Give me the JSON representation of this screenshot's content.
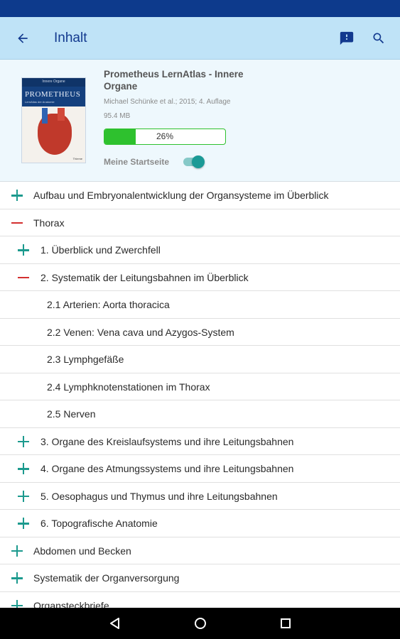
{
  "app_bar": {
    "title": "Inhalt",
    "back_icon": "arrow-back-icon",
    "actions": [
      "feedback-icon",
      "search-icon"
    ],
    "background": "#bfe3f7",
    "title_color": "#12398e"
  },
  "book": {
    "title": "Prometheus LernAtlas - Innere Organe",
    "author": "Michael Schünke et al.; 2015; 4. Auflage",
    "size": "95.4 MB",
    "progress": 0.26,
    "progress_label": "26%",
    "startseite_label": "Meine Startseite",
    "startseite_on": true,
    "cover": {
      "brand": "PROMETHEUS",
      "band": "Innere Organe",
      "subtitle": "LernAtlas der Anatomie",
      "publisher": "Thieme"
    }
  },
  "toc": [
    {
      "level": 0,
      "expanded": false,
      "label": "Aufbau und Embryonalentwicklung der Organsysteme im Überblick"
    },
    {
      "level": 0,
      "expanded": true,
      "label": "Thorax"
    },
    {
      "level": 1,
      "expanded": false,
      "label": "1. Überblick und Zwerchfell"
    },
    {
      "level": 1,
      "expanded": true,
      "label": "2. Systematik der Leitungsbahnen im Überblick"
    },
    {
      "level": 2,
      "label": "2.1 Arterien: Aorta thoracica"
    },
    {
      "level": 2,
      "label": "2.2 Venen: Vena cava und Azygos-System"
    },
    {
      "level": 2,
      "label": "2.3 Lymphgefäße"
    },
    {
      "level": 2,
      "label": "2.4 Lymphknotenstationen im Thorax"
    },
    {
      "level": 2,
      "label": "2.5 Nerven"
    },
    {
      "level": 1,
      "expanded": false,
      "label": "3. Organe des Kreislaufsystems und ihre Leitungsbahnen"
    },
    {
      "level": 1,
      "expanded": false,
      "label": "4. Organe des Atmungssystems und ihre Leitungsbahnen"
    },
    {
      "level": 1,
      "expanded": false,
      "label": "5. Oesophagus und Thymus und ihre Leitungsbahnen"
    },
    {
      "level": 1,
      "expanded": false,
      "label": "6. Topografische Anatomie"
    },
    {
      "level": 0,
      "expanded": false,
      "label": "Abdomen und Becken"
    },
    {
      "level": 0,
      "expanded": false,
      "label": "Systematik der Organversorgung"
    },
    {
      "level": 0,
      "expanded": false,
      "label": "Organsteckbriefe"
    }
  ],
  "nav_bar": [
    "back-triangle-icon",
    "home-circle-icon",
    "recents-square-icon"
  ]
}
